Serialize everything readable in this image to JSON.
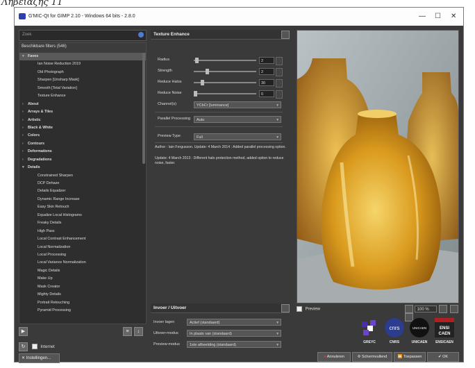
{
  "caption": "Λήβειάζης 11",
  "window": {
    "title": "G'MIC-Qt for GIMP 2.10 - Windows 64 bits - 2.8.0",
    "controls": [
      "—",
      "☐",
      "✕"
    ]
  },
  "left": {
    "search_placeholder": "Zoek",
    "filters_header": "Beschikbare filters (546)",
    "items": [
      {
        "label": "Faves",
        "type": "cat",
        "expanded": true,
        "selected": true
      },
      {
        "label": "Ian Noise Reduction 2019",
        "type": "sub"
      },
      {
        "label": "Old Photograph",
        "type": "sub"
      },
      {
        "label": "Sharpen [Unsharp Mask]",
        "type": "sub"
      },
      {
        "label": "Smooth [Total Variation]",
        "type": "sub"
      },
      {
        "label": "Texture Enhance",
        "type": "sub"
      },
      {
        "label": "About",
        "type": "cat"
      },
      {
        "label": "Arrays & Tiles",
        "type": "cat"
      },
      {
        "label": "Artistic",
        "type": "cat"
      },
      {
        "label": "Black & White",
        "type": "cat"
      },
      {
        "label": "Colors",
        "type": "cat"
      },
      {
        "label": "Contours",
        "type": "cat"
      },
      {
        "label": "Deformations",
        "type": "cat"
      },
      {
        "label": "Degradations",
        "type": "cat"
      },
      {
        "label": "Details",
        "type": "cat",
        "expanded": true
      },
      {
        "label": "Constrained Sharpen",
        "type": "sub"
      },
      {
        "label": "DCP Dehaze",
        "type": "sub"
      },
      {
        "label": "Details Equalizer",
        "type": "sub"
      },
      {
        "label": "Dynamic Range Increase",
        "type": "sub"
      },
      {
        "label": "Easy Skin Retouch",
        "type": "sub"
      },
      {
        "label": "Equalize Local Histograms",
        "type": "sub"
      },
      {
        "label": "Freaky Details",
        "type": "sub"
      },
      {
        "label": "High Pass",
        "type": "sub"
      },
      {
        "label": "Local Contrast Enhancement",
        "type": "sub"
      },
      {
        "label": "Local Normalization",
        "type": "sub"
      },
      {
        "label": "Local Processing",
        "type": "sub"
      },
      {
        "label": "Local Variance Normalization",
        "type": "sub"
      },
      {
        "label": "Magic Details",
        "type": "sub"
      },
      {
        "label": "Make Up",
        "type": "sub"
      },
      {
        "label": "Mask Creator",
        "type": "sub"
      },
      {
        "label": "Mighty Details",
        "type": "sub"
      },
      {
        "label": "Portrait Retouching",
        "type": "sub"
      },
      {
        "label": "Pyramid Processing",
        "type": "sub"
      }
    ],
    "internet_label": "Internet",
    "settings_label": "Instellingen..."
  },
  "filter": {
    "title": "Texture Enhance",
    "params": [
      {
        "label": "Radius",
        "value": "2",
        "fraction": 0.02
      },
      {
        "label": "Strength",
        "value": "2",
        "fraction": 0.2
      },
      {
        "label": "Reduce Halos",
        "value": "30",
        "fraction": 0.12
      },
      {
        "label": "Reduce Noise",
        "value": "0",
        "fraction": 0.0
      }
    ],
    "channels_label": "Channel(s)",
    "channels_value": "YCbCr [luminance]",
    "parallel_label": "Parallel Processing",
    "parallel_value": "Auto",
    "preview_type_label": "Preview Type",
    "preview_type_value": "Full",
    "info1": "Author : Iain Fergusson. Update: 4 March 2014 : Added parallel processing option.",
    "info2": "Update: 4 March 2013 : Different halo protection method, added option to reduce noise, faster."
  },
  "io": {
    "title": "Invoer / Uitvoer",
    "rows": [
      {
        "label": "Invoer lagen",
        "value": "Actief (standaard)"
      },
      {
        "label": "Uitvoer-modus",
        "value": "In plaats van (standaard)"
      },
      {
        "label": "Preview-modus",
        "value": "1ste afbeelding (standaard)"
      }
    ]
  },
  "preview": {
    "checkbox_label": "Preview",
    "zoom": "100 %"
  },
  "logos": [
    "GREYC",
    "CNRS",
    "UNICAEN",
    "ENSICAEN"
  ],
  "logo_texts": {
    "cnrs": "cnrs",
    "unicaen": "UNICAEN",
    "ensicaen": "ENSI CAEN"
  },
  "actions": {
    "cancel": "Annuleren",
    "fullscreen": "Schermvullend",
    "apply": "Toepassen",
    "ok": "OK"
  }
}
